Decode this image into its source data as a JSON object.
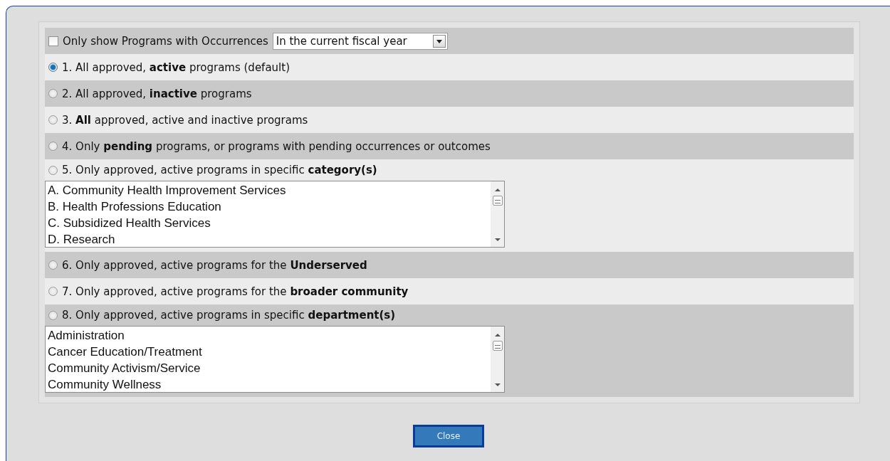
{
  "filter": {
    "label": "Only show Programs with Occurrences",
    "checked": false,
    "period": "In the current fiscal year"
  },
  "options": [
    {
      "kind": "plain",
      "label": "1. All approved, **active** programs (default)",
      "selected": true
    },
    {
      "kind": "plain",
      "label": "2. All approved, **inactive** programs",
      "selected": false
    },
    {
      "kind": "plain",
      "label": "3. **All** approved, active and inactive programs",
      "selected": false
    },
    {
      "kind": "plain",
      "label": "4. Only **pending** programs, or programs with pending occurrences or outcomes",
      "selected": false
    },
    {
      "kind": "list",
      "label": "5. Only approved, active programs in specific **category(s)**",
      "selected": false,
      "items": [
        "A. Community Health Improvement Services",
        "B. Health Professions Education",
        "C. Subsidized Health Services",
        "D. Research"
      ]
    },
    {
      "kind": "plain",
      "label": "6. Only approved, active programs for the **Underserved**",
      "selected": false
    },
    {
      "kind": "plain",
      "label": "7. Only approved, active programs for the **broader community**",
      "selected": false
    },
    {
      "kind": "list",
      "label": "8. Only approved, active programs in specific **department(s)**",
      "selected": false,
      "items": [
        "Administration",
        "Cancer Education/Treatment",
        "Community Activism/Service",
        "Community Wellness"
      ]
    }
  ],
  "buttons": [
    {
      "label": "Close"
    }
  ]
}
